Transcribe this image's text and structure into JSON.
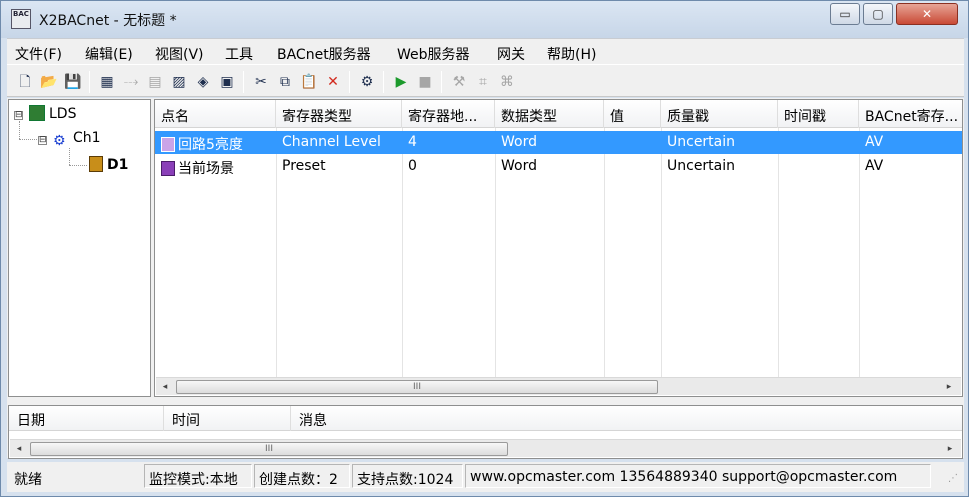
{
  "window": {
    "title": "X2BACnet - 无标题 *",
    "app_icon_text": "BAC",
    "minimize": "▭",
    "maximize": "▢",
    "close": "✕"
  },
  "menu": [
    {
      "label": "文件(F)"
    },
    {
      "label": "编辑(E)"
    },
    {
      "label": "视图(V)"
    },
    {
      "label": "工具"
    },
    {
      "label": "BACnet服务器"
    },
    {
      "label": "Web服务器"
    },
    {
      "label": "网关"
    },
    {
      "label": "帮助(H)"
    }
  ],
  "toolbar": {
    "icons": [
      {
        "name": "new-icon",
        "glyph": "🗋",
        "enabled": true
      },
      {
        "name": "open-icon",
        "glyph": "📂",
        "enabled": true
      },
      {
        "name": "save-icon",
        "glyph": "💾",
        "enabled": true
      },
      {
        "name": "add-database-icon",
        "glyph": "▦",
        "enabled": true
      },
      {
        "name": "add-channel-icon",
        "glyph": "⤏",
        "enabled": false
      },
      {
        "name": "add-device-icon",
        "glyph": "▤",
        "enabled": false
      },
      {
        "name": "add-group-icon",
        "glyph": "▨",
        "enabled": true
      },
      {
        "name": "add-tag-icon",
        "glyph": "◈",
        "enabled": true
      },
      {
        "name": "properties-icon",
        "glyph": "▣",
        "enabled": true
      },
      {
        "name": "cut-icon",
        "glyph": "✂",
        "enabled": true
      },
      {
        "name": "copy-icon",
        "glyph": "⧉",
        "enabled": true
      },
      {
        "name": "paste-icon",
        "glyph": "📋",
        "enabled": false
      },
      {
        "name": "delete-icon",
        "glyph": "✕",
        "enabled": true
      },
      {
        "name": "monitor-icon",
        "glyph": "⚙",
        "enabled": true
      },
      {
        "name": "start-icon",
        "glyph": "▶",
        "enabled": true
      },
      {
        "name": "stop-icon",
        "glyph": "■",
        "enabled": false
      },
      {
        "name": "tool-a-icon",
        "glyph": "⚒",
        "enabled": false
      },
      {
        "name": "tool-b-icon",
        "glyph": "⌗",
        "enabled": false
      },
      {
        "name": "tool-c-icon",
        "glyph": "⌘",
        "enabled": false
      }
    ],
    "colors": {
      "enabled": "#1f2f4f",
      "disabled": "#a6a6a6",
      "start": "#1c9a2c",
      "delete": "#d22a1e"
    }
  },
  "tree": {
    "expander": "⊟",
    "nodes": [
      {
        "label": "LDS"
      },
      {
        "label": "Ch1"
      },
      {
        "label": "D1"
      }
    ]
  },
  "grid": {
    "columns": [
      "点名",
      "寄存器类型",
      "寄存器地...",
      "数据类型",
      "值",
      "质量戳",
      "时间戳",
      "BACnet寄存..."
    ],
    "rows": [
      {
        "cells": [
          "回路5亮度",
          "Channel Level",
          "4",
          "Word",
          "",
          "Uncertain",
          "",
          "AV"
        ],
        "selected": true
      },
      {
        "cells": [
          "当前场景",
          "Preset",
          "0",
          "Word",
          "",
          "Uncertain",
          "",
          "AV"
        ],
        "selected": false
      }
    ],
    "scroll_left": "◂",
    "scroll_right": "▸",
    "thumb_grip": "III"
  },
  "log": {
    "columns": [
      "日期",
      "时间",
      "消息"
    ],
    "thumb_grip": "III"
  },
  "statusbar": {
    "ready": "就绪",
    "mode": "监控模式:本地",
    "created": "创建点数：2",
    "supported": "支持点数:1024",
    "contact": "www.opcmaster.com 13564889340 support@opcmaster.com",
    "grip": "⋰"
  }
}
